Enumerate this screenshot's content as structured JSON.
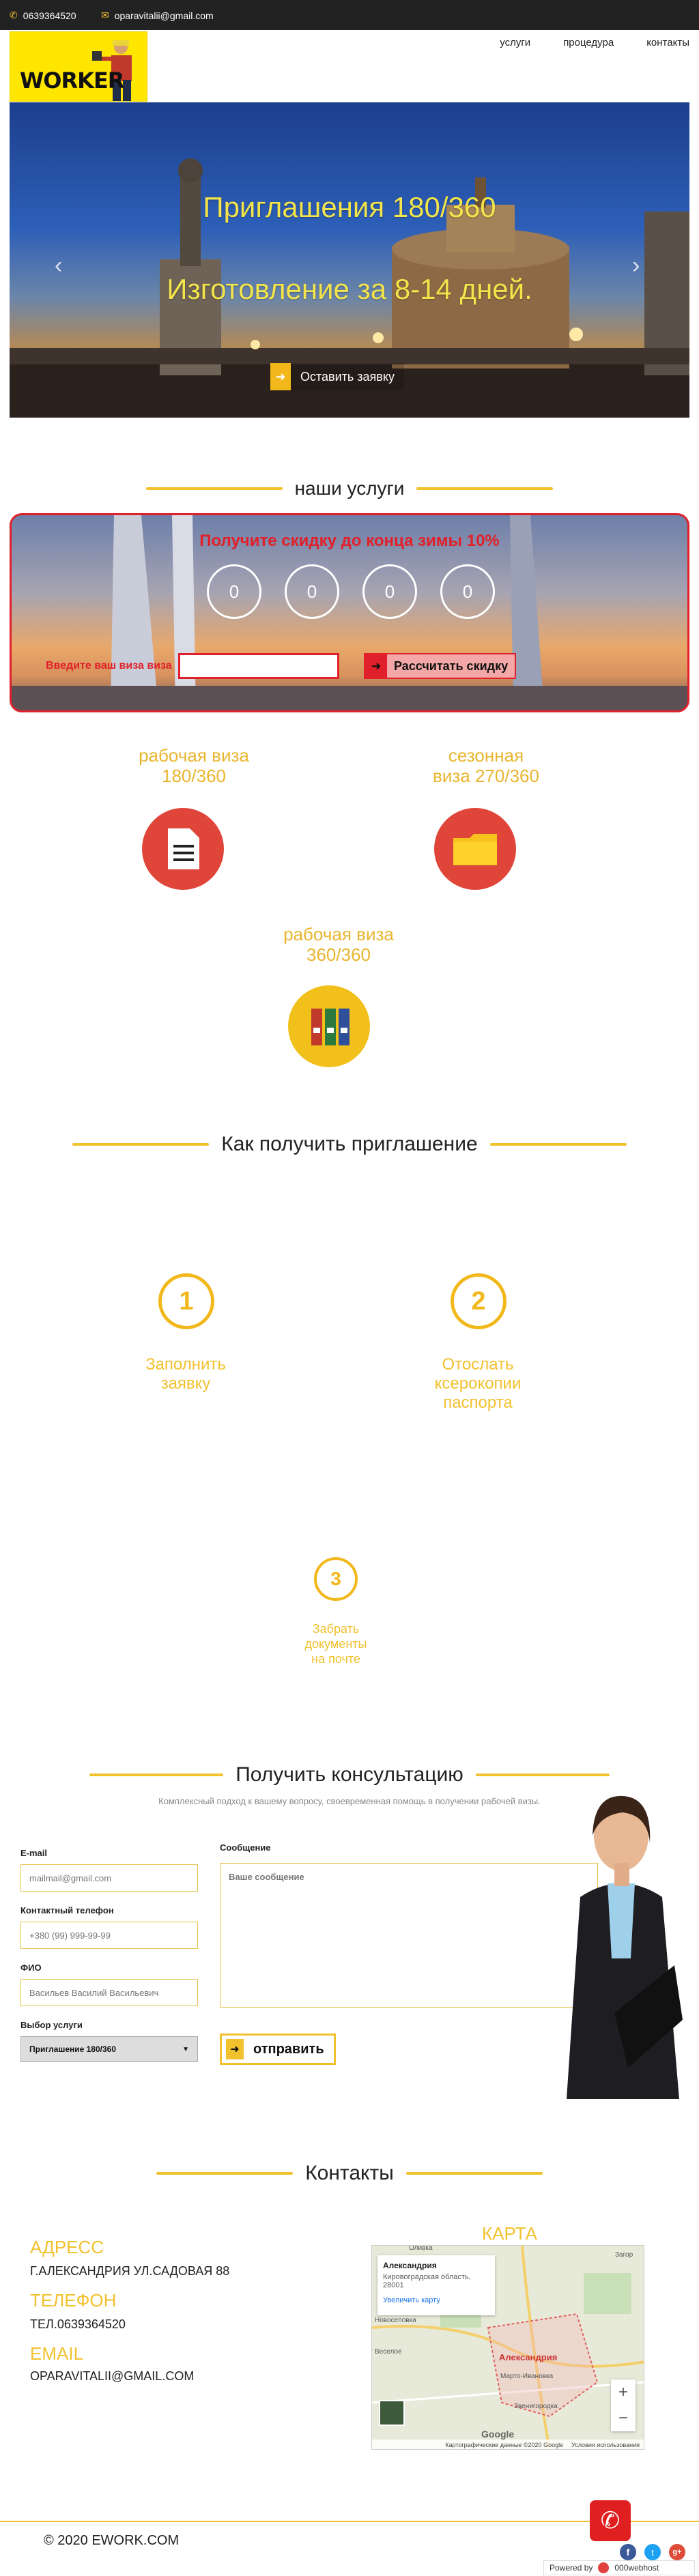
{
  "topbar": {
    "phone": "0639364520",
    "email": "oparavitalii@gmail.com"
  },
  "logo": {
    "text": "WORKER"
  },
  "nav": {
    "items": [
      "услуги",
      "процедура",
      "контакты"
    ]
  },
  "hero": {
    "line1": "Приглашения 180/360",
    "line2": "Изготовление за 8-14 дней.",
    "cta_label": "Оставить заявку"
  },
  "services_section": {
    "title": "наши услуги"
  },
  "promo": {
    "title": "Получите скидку до конца зимы 10%",
    "countdown": [
      "0",
      "0",
      "0",
      "0"
    ],
    "input_label": "Введите ваш виза виза",
    "input_value": "",
    "button_label": "Рассчитать скидку"
  },
  "services": [
    {
      "title": "рабочая виза 180/360",
      "line1": "рабочая виза",
      "line2": "180/360",
      "icon": "document-icon",
      "color": "#e0453a"
    },
    {
      "title": "сезонная виза 270/360",
      "line1": "сезонная",
      "line2": "виза 270/360",
      "icon": "folder-icon",
      "color": "#e0453a"
    },
    {
      "title": "рабочая виза 360/360",
      "line1": "рабочая виза",
      "line2": "360/360",
      "icon": "binders-icon",
      "color": "#f2b81b"
    }
  ],
  "how_section": {
    "title": "Как получить приглашение"
  },
  "steps": [
    {
      "num": "1",
      "line1": "Заполнить",
      "line2": "заявку",
      "line3": ""
    },
    {
      "num": "2",
      "line1": "Отослать",
      "line2": "ксерокопии",
      "line3": "паспорта"
    },
    {
      "num": "3",
      "line1": "Забрать",
      "line2": "документы",
      "line3": "на почте"
    }
  ],
  "consult": {
    "title": "Получить консультацию",
    "subtitle": "Комплексный подход к вашему вопросу, своевременная помощь в получении рабочей визы.",
    "email_label": "E-mail",
    "email_placeholder": "mailmail@gmail.com",
    "phone_label": "Контактный телефон",
    "phone_placeholder": "+380 (99) 999-99-99",
    "name_label": "ФИО",
    "name_placeholder": "Васильев Василий Васильевич",
    "service_label": "Выбор услуги",
    "service_value": "Приглашение 180/360",
    "message_label": "Сообщение",
    "message_placeholder": "Ваше сообщение",
    "submit_label": "отправить"
  },
  "contacts": {
    "title": "Контакты",
    "address_head": "АДРЕСС",
    "address": "Г.АЛЕКСАНДРИЯ УЛ.САДОВАЯ 88",
    "phone_head": "ТЕЛЕФОН",
    "phone": "ТЕЛ.0639364520",
    "email_head": "EMAIL",
    "email": "OPARAVITALII@GMAIL.COM",
    "map_head": "КАРТА"
  },
  "map": {
    "place": "Александрия",
    "region": "Кировоградская область, 28001",
    "enlarge": "Увеличить карту",
    "city_label": "Александрия",
    "towns": [
      "Оливка",
      "Загор",
      "Новоселовка",
      "Веселое",
      "Марто-Ивановка",
      "Звенигородка"
    ],
    "zoom_in": "+",
    "zoom_out": "−",
    "google": "Google",
    "attribution": "Картографические данные ©2020 Google",
    "terms": "Условия использования"
  },
  "footer": {
    "copyright": "© 2020 EWORK.COM",
    "powered_by": "Powered by",
    "host": "000webhost"
  },
  "colors": {
    "accent": "#f2c12e",
    "dark": "#222222",
    "red": "#e0202a"
  }
}
